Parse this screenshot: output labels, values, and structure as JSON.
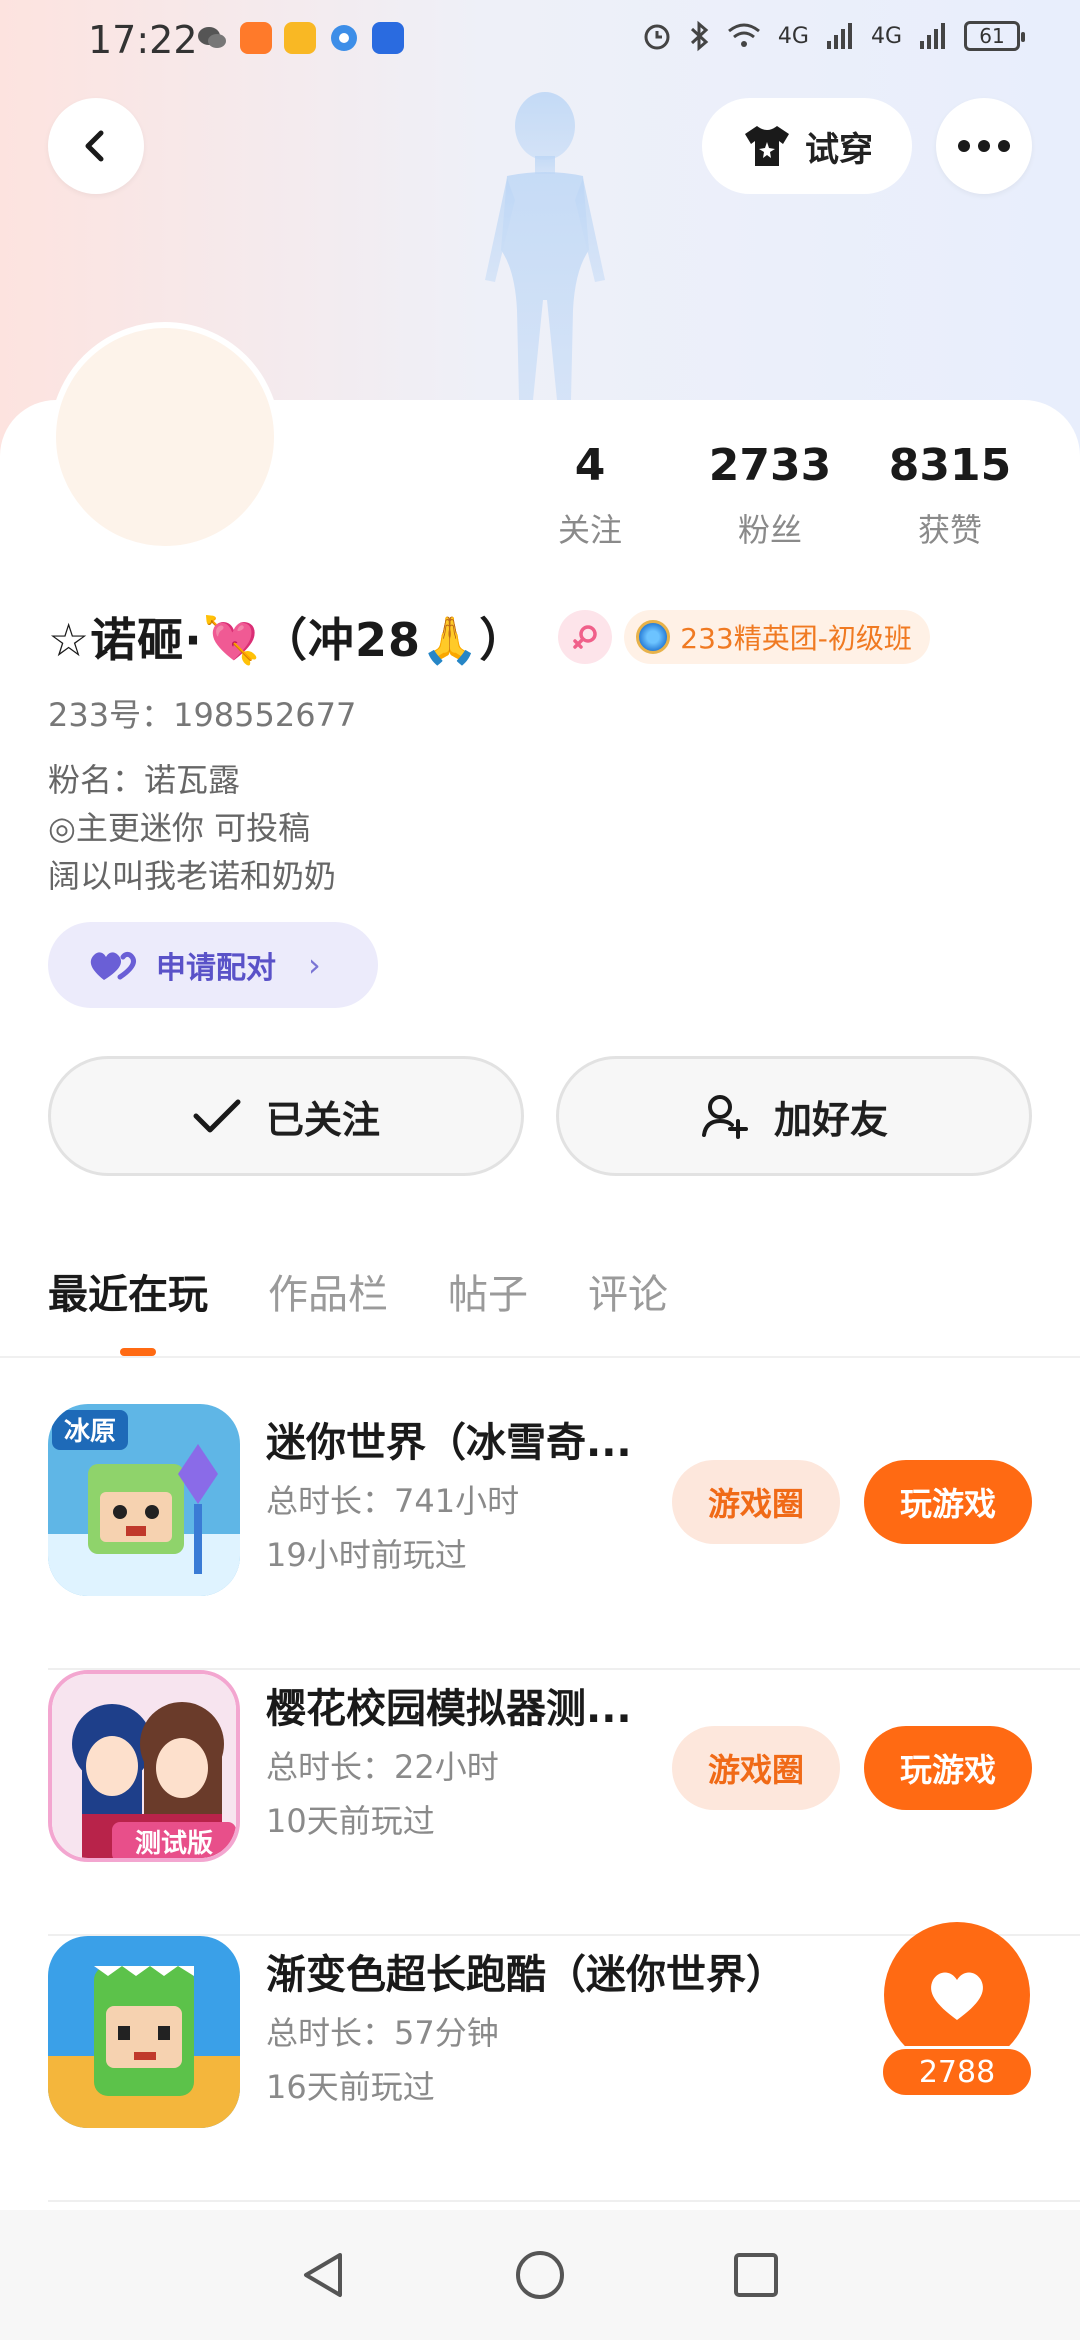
{
  "status_bar": {
    "time": "17:22",
    "net1": "4G",
    "net2": "4G",
    "battery": "61"
  },
  "header": {
    "try_on_label": "试穿"
  },
  "profile": {
    "username": "☆诺砸·💘（冲28🙏）",
    "elite_badge": "233精英团-初级班",
    "user_id": "233号：198552677",
    "bio_lines": [
      "粉名：诺瓦露",
      "◎主更迷你 可投稿",
      "阔以叫我老诺和奶奶"
    ],
    "pair_label": "申请配对"
  },
  "stats": [
    {
      "value": "4",
      "label": "关注"
    },
    {
      "value": "2733",
      "label": "粉丝"
    },
    {
      "value": "8315",
      "label": "获赞"
    }
  ],
  "actions": {
    "follow_label": "已关注",
    "add_friend_label": "加好友"
  },
  "tabs": [
    {
      "label": "最近在玩",
      "active": true
    },
    {
      "label": "作品栏",
      "active": false
    },
    {
      "label": "帖子",
      "active": false
    },
    {
      "label": "评论",
      "active": false
    }
  ],
  "games": [
    {
      "title": "迷你世界（冰雪奇...",
      "duration": "总时长：741小时",
      "last_played": "19小时前玩过",
      "circle_label": "游戏圈",
      "play_label": "玩游戏",
      "icon_text": "冰原"
    },
    {
      "title": "樱花校园模拟器测...",
      "duration": "总时长：22小时",
      "last_played": "10天前玩过",
      "circle_label": "游戏圈",
      "play_label": "玩游戏",
      "icon_text": "测试版"
    },
    {
      "title": "渐变色超长跑酷（迷你世界）",
      "duration": "总时长：57分钟",
      "last_played": "16天前玩过"
    }
  ],
  "like_float": {
    "count": "2788"
  },
  "colors": {
    "accent": "#ff6a13",
    "pair_purple": "#5a52c8"
  }
}
